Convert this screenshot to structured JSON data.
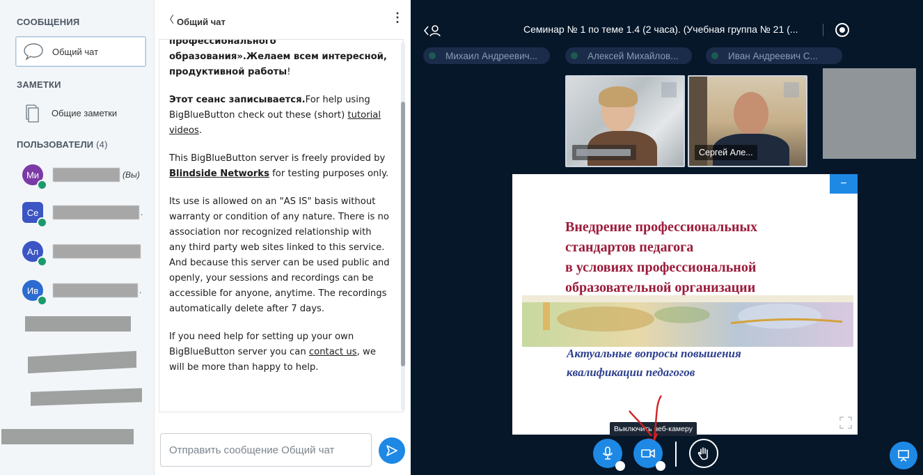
{
  "sidebar": {
    "messages_title": "СООБЩЕНИЯ",
    "public_chat_label": "Общий чат",
    "notes_title": "ЗАМЕТКИ",
    "shared_notes_label": "Общие заметки",
    "users_title": "ПОЛЬЗОВАТЕЛИ",
    "users_count": "(4)",
    "users": [
      {
        "initials": "Ми",
        "color": "#7b3aa6",
        "you_label": "(Вы)"
      },
      {
        "initials": "Се",
        "color": "#3b55c4",
        "suffix": "."
      },
      {
        "initials": "Ал",
        "color": "#3b55c4",
        "suffix": ""
      },
      {
        "initials": "Ив",
        "color": "#2c6bd0",
        "suffix": "."
      }
    ]
  },
  "chat": {
    "back_label": "〈",
    "title": "Общий чат",
    "menu_label": "⋮",
    "welcome_line1": "профессионального",
    "welcome_line2": "образования».Желаем всем интересной,",
    "welcome_line3": "продуктивной работы",
    "welcome_end": "!",
    "recording_bold": "Этот сеанс записывается.",
    "recording_rest": "For help using BigBlueButton check out these (short) ",
    "tutorial_link": "tutorial videos",
    "recording_end": ".",
    "server_text_pre": "This BigBlueButton server is freely provided by ",
    "blindside_link": "Blindside Networks",
    "server_text_post": " for testing purposes only.",
    "asis_text": "Its use is allowed on an \"AS IS\" basis without warranty or condition of any nature. There is no association nor recognized relationship with any third party web sites linked to this service. And because this server can be used public and openly, your sessions and recordings can be accessible for anyone, anytime. The recordings automatically delete after 7 days.",
    "help_pre": "If you need help for setting up your own BigBlueButton server you can ",
    "contact_link": "contact us",
    "help_post": ", we will be more than happy to help.",
    "input_placeholder": "Отправить сообщение Общий чат"
  },
  "main": {
    "session_title": "Семинар № 1 по теме 1.4 (2 часа). (Учебная группа № 21 (...",
    "talkers": [
      "Михаил Андреевич...",
      "Алексей Михайлов...",
      "Иван Андреевич С..."
    ],
    "webcams": [
      {
        "name": ""
      },
      {
        "name": "Сергей Але..."
      }
    ],
    "slide": {
      "title_lines": [
        "Внедрение профессиональных",
        "стандартов педагога",
        "в условиях профессиональной",
        "образовательной организации"
      ],
      "subtitle_lines": [
        "Актуальные вопросы повышения",
        "квалификации педагогов"
      ],
      "minimize_label": "−"
    },
    "tooltip": "Выключить веб-камеру"
  },
  "colors": {
    "accent": "#1e88e5",
    "main_bg": "#06172a",
    "talker_bg": "#1a2c4a",
    "slide_title": "#9b1b3a",
    "slide_subtitle": "#2d3f8f"
  }
}
